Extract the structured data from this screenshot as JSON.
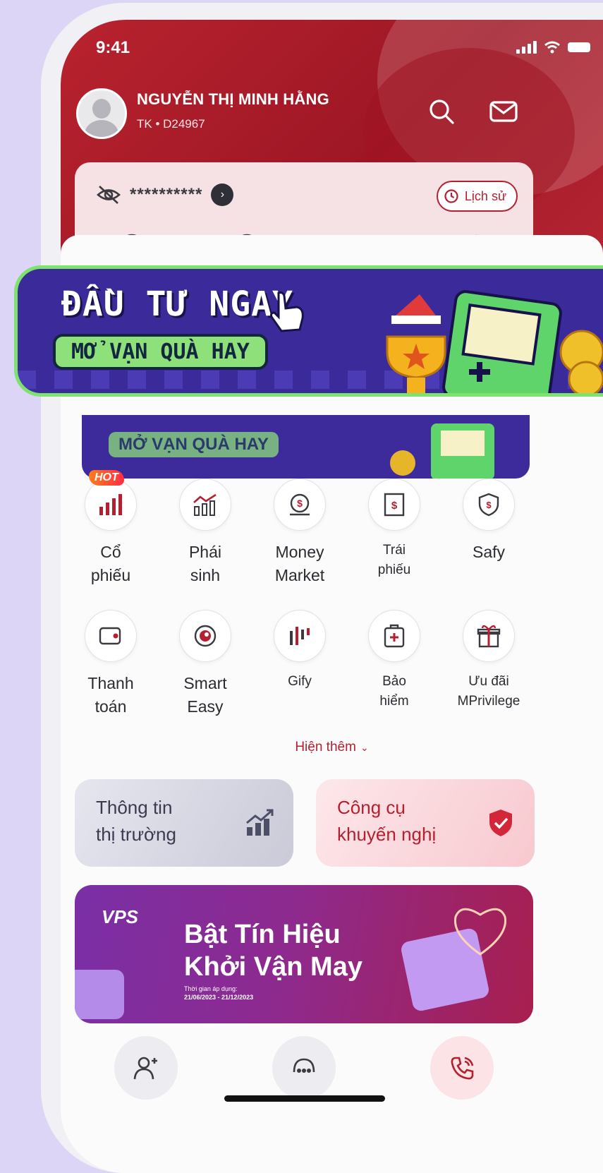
{
  "status_bar": {
    "time": "9:41"
  },
  "user": {
    "name": "NGUYỄN THỊ MINH HẰNG",
    "account": "TK • D24967"
  },
  "balance": {
    "masked": "**********",
    "history_label": "Lịch sử"
  },
  "promo": {
    "title": "ĐẦU TƯ NGAY",
    "subtitle": "MỞ VẠN QUÀ HAY"
  },
  "services": [
    {
      "label": "Cổ\nphiếu",
      "icon": "stock-chart-icon",
      "badge": "HOT"
    },
    {
      "label": "Phái\nsinh",
      "icon": "derivative-chart-icon"
    },
    {
      "label": "Money\nMarket",
      "icon": "money-market-icon"
    },
    {
      "label": "Trái\nphiếu",
      "icon": "bond-icon"
    },
    {
      "label": "Safy",
      "icon": "shield-dollar-icon"
    },
    {
      "label": "Thanh\ntoán",
      "icon": "wallet-icon"
    },
    {
      "label": "Smart\nEasy",
      "icon": "target-icon"
    },
    {
      "label": "Gify",
      "icon": "gify-icon"
    },
    {
      "label": "Bảo\nhiểm",
      "icon": "insurance-icon"
    },
    {
      "label": "Ưu đãi\nMPrivilege",
      "icon": "gift-icon"
    }
  ],
  "show_more": "Hiện thêm",
  "cards": {
    "market": "Thông tin\nthị trường",
    "tools": "Công cụ\nkhuyến nghị"
  },
  "vps_banner": {
    "logo": "VPS",
    "title": "Bật Tín Hiệu\nKhởi Vận May",
    "period_label": "Thời gian áp dụng:",
    "period": "21/06/2023 - 21/12/2023"
  },
  "colors": {
    "brand_red": "#b51f2f",
    "promo_green": "#7ee36d",
    "promo_purple": "#3b2a9a"
  }
}
